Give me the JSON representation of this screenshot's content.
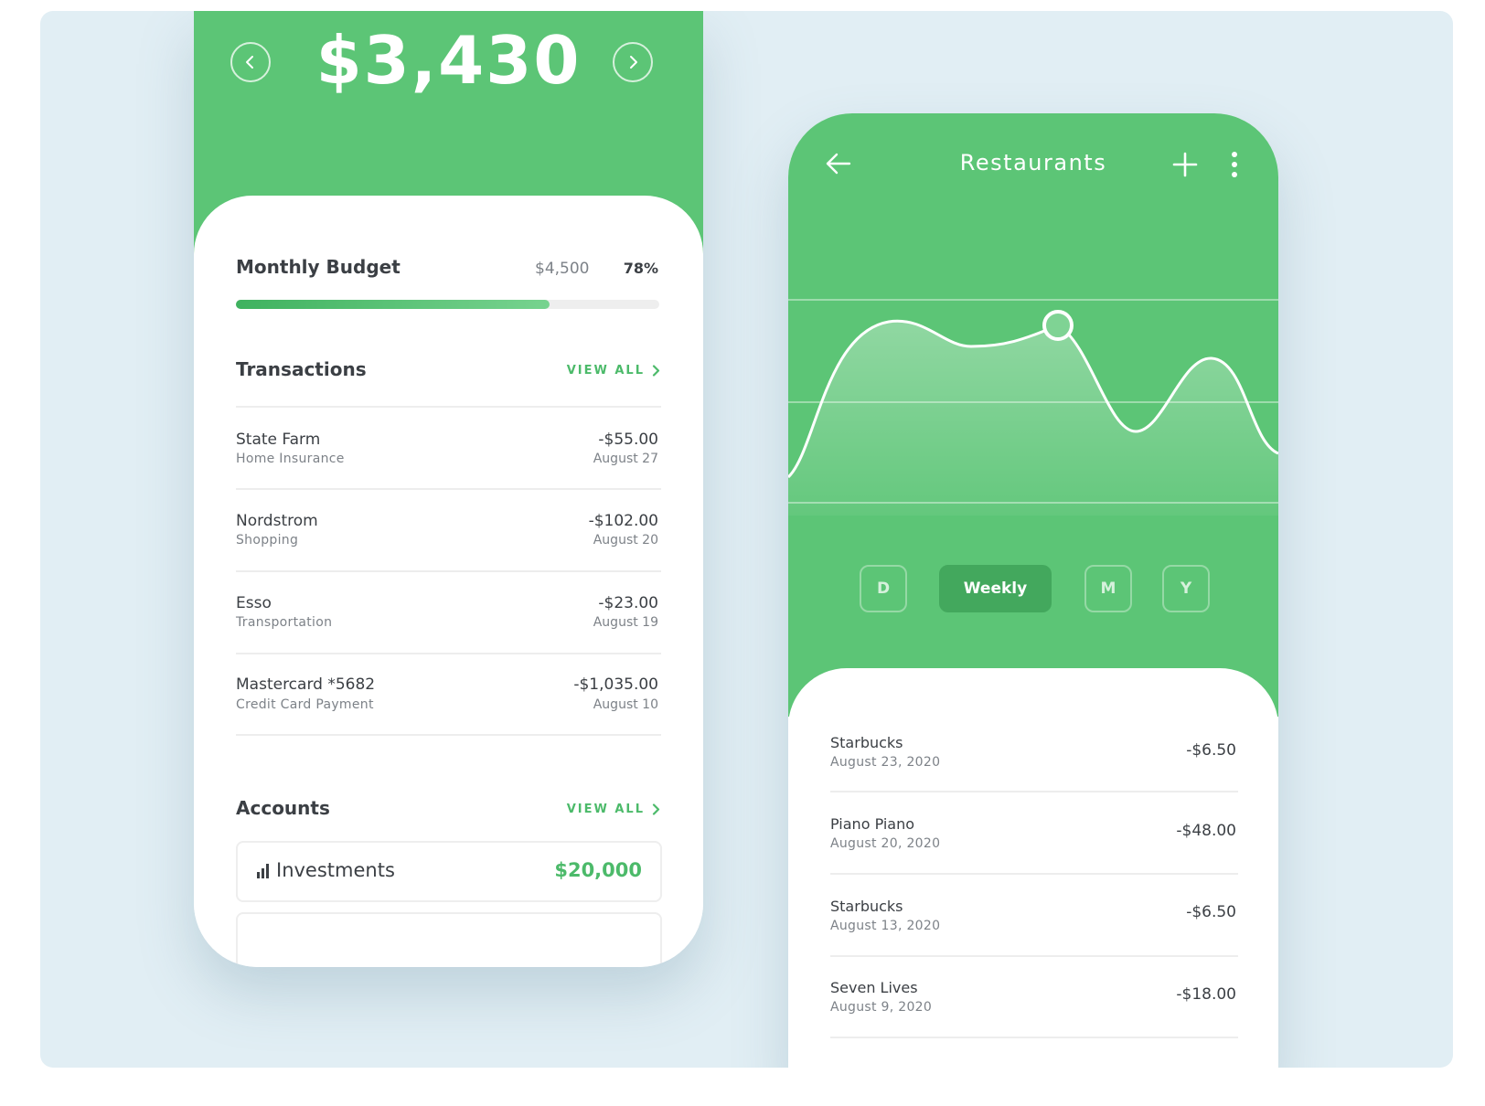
{
  "colors": {
    "brand_green": "#5cc576",
    "accent_green": "#4cba6a",
    "active_period": "#43a85d"
  },
  "left_screen": {
    "balance": "$3,430",
    "budget": {
      "title": "Monthly Budget",
      "limit": "$4,500",
      "percent": "78%",
      "fill_fraction": 0.74
    },
    "transactions": {
      "title": "Transactions",
      "view_all": "VIEW ALL",
      "items": [
        {
          "name": "State Farm",
          "category": "Home Insurance",
          "amount": "-$55.00",
          "date": "August 27"
        },
        {
          "name": "Nordstrom",
          "category": "Shopping",
          "amount": "-$102.00",
          "date": "August 20"
        },
        {
          "name": "Esso",
          "category": "Transportation",
          "amount": "-$23.00",
          "date": "August 19"
        },
        {
          "name": "Mastercard *5682",
          "category": "Credit Card Payment",
          "amount": "-$1,035.00",
          "date": "August 10"
        }
      ]
    },
    "accounts": {
      "title": "Accounts",
      "view_all": "VIEW ALL",
      "items": [
        {
          "name": "Investments",
          "value": "$20,000",
          "icon": "bar-chart-icon"
        }
      ]
    }
  },
  "right_screen": {
    "title": "Restaurants",
    "icons": [
      "back-arrow-icon",
      "plus-icon",
      "more-vertical-icon"
    ],
    "periods": [
      {
        "label": "D",
        "active": false
      },
      {
        "label": "Weekly",
        "active": true
      },
      {
        "label": "M",
        "active": false
      },
      {
        "label": "Y",
        "active": false
      }
    ],
    "items": [
      {
        "name": "Starbucks",
        "date": "August 23, 2020",
        "amount": "-$6.50"
      },
      {
        "name": "Piano Piano",
        "date": "August 20, 2020",
        "amount": "-$48.00"
      },
      {
        "name": "Starbucks",
        "date": "August 13, 2020",
        "amount": "-$6.50"
      },
      {
        "name": "Seven Lives",
        "date": "August 9, 2020",
        "amount": "-$18.00"
      }
    ]
  }
}
